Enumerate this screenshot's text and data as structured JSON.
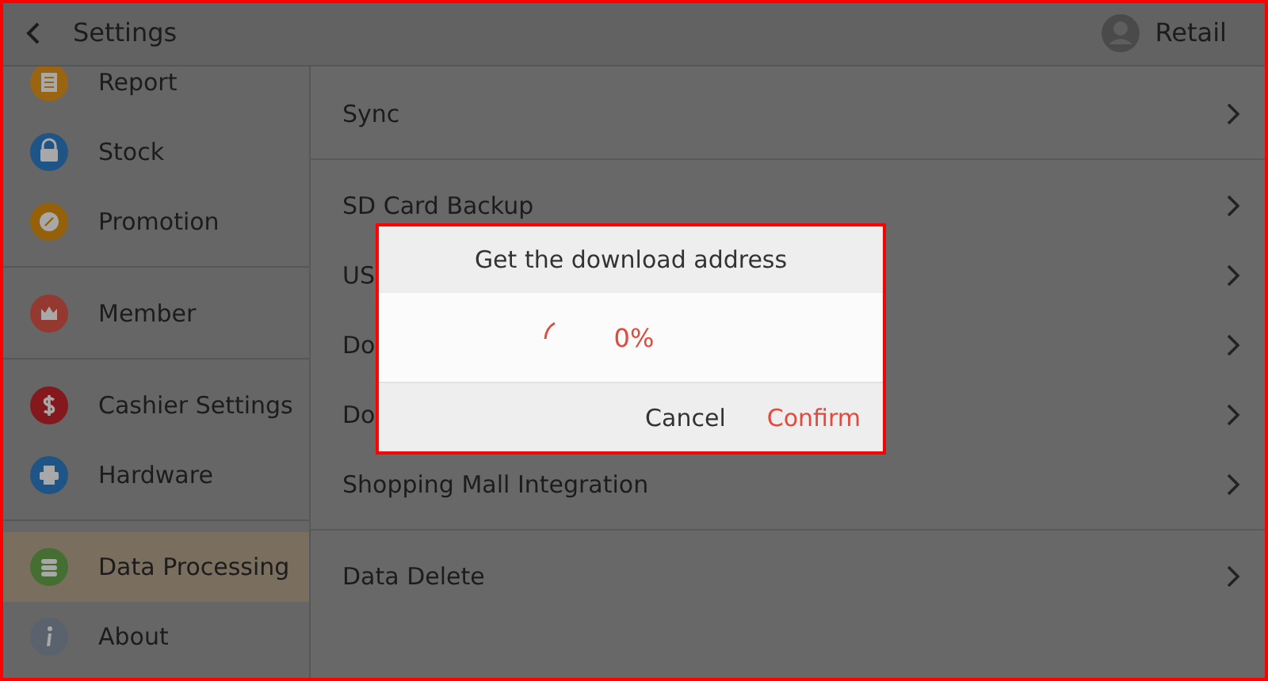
{
  "header": {
    "title": "Settings",
    "user": "Retail"
  },
  "sidebar": {
    "groups": [
      {
        "items": [
          {
            "label": "Report",
            "kind": "report",
            "color": "#9a6512",
            "selected": false
          },
          {
            "label": "Stock",
            "kind": "stock",
            "color": "#1e5486",
            "selected": false
          },
          {
            "label": "Promotion",
            "kind": "promotion",
            "color": "#94600a",
            "selected": false
          }
        ]
      },
      {
        "items": [
          {
            "label": "Member",
            "kind": "member",
            "color": "#93392f",
            "selected": false
          }
        ]
      },
      {
        "items": [
          {
            "label": "Cashier Settings",
            "kind": "cashier",
            "color": "#84191d",
            "selected": false
          },
          {
            "label": "Hardware",
            "kind": "hardware",
            "color": "#1e5486",
            "selected": false
          }
        ]
      },
      {
        "items": [
          {
            "label": "Data Processing",
            "kind": "data",
            "color": "#456e33",
            "selected": true
          },
          {
            "label": "About",
            "kind": "about",
            "color": "#5a636d",
            "selected": false
          }
        ]
      }
    ]
  },
  "settings": {
    "groups": [
      {
        "rows": [
          {
            "label": "Sync"
          }
        ]
      },
      {
        "rows": [
          {
            "label": "SD Card Backup"
          },
          {
            "label": "US"
          },
          {
            "label": "Do"
          },
          {
            "label": "Do"
          },
          {
            "label": "Shopping Mall Integration"
          }
        ]
      },
      {
        "rows": [
          {
            "label": "Data Delete"
          }
        ]
      }
    ]
  },
  "dialog": {
    "title": "Get the download address",
    "progress": "0%",
    "buttons": [
      {
        "label": "Cancel",
        "kind": "neutral"
      },
      {
        "label": "Confirm",
        "kind": "primary"
      }
    ]
  }
}
